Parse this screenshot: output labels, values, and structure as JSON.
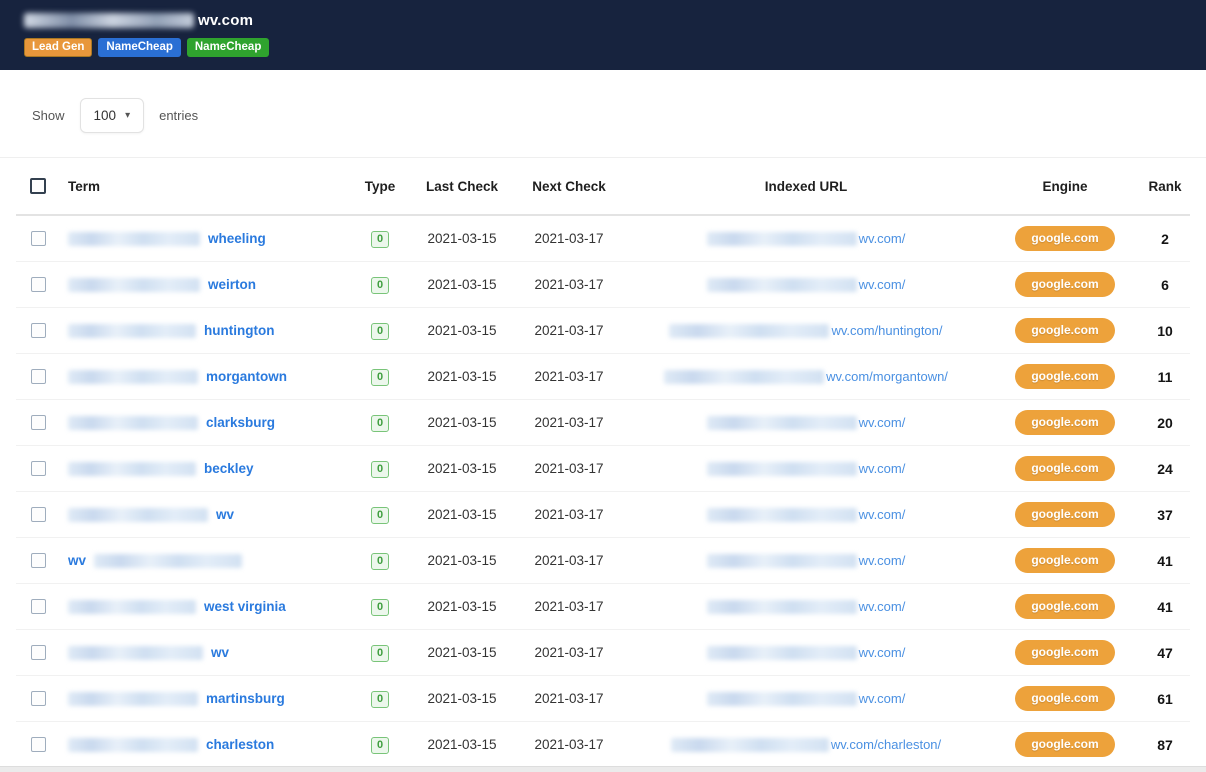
{
  "colors": {
    "header_bg": "#17233e",
    "engine_pill_orange": "#eda23b",
    "link_blue": "#2a7ade",
    "type_badge_green": "#3f9e3f",
    "badge_orange": "#e8973b",
    "badge_blue": "#2a6fd4",
    "badge_green": "#2fa32e"
  },
  "header": {
    "title_visible": "wv.com",
    "title_redacted": true,
    "badges": [
      {
        "label": "Lead Gen"
      },
      {
        "label": "NameCheap"
      },
      {
        "label": "NameCheap"
      }
    ]
  },
  "controls": {
    "show_label": "Show",
    "page_size": "100",
    "entries_label": "entries"
  },
  "table": {
    "headers": {
      "term": "Term",
      "type": "Type",
      "last_check": "Last Check",
      "next_check": "Next Check",
      "indexed_url": "Indexed URL",
      "engine": "Engine",
      "rank": "Rank"
    },
    "rows": [
      {
        "term": "wheeling",
        "term_blur_position": "before",
        "term_blur_width": 132,
        "type": "0",
        "last_check": "2021-03-15",
        "next_check": "2021-03-17",
        "url": "wv.com/",
        "url_blur_width": 150,
        "engine": "google.com",
        "rank": "2"
      },
      {
        "term": "weirton",
        "term_blur_position": "before",
        "term_blur_width": 132,
        "type": "0",
        "last_check": "2021-03-15",
        "next_check": "2021-03-17",
        "url": "wv.com/",
        "url_blur_width": 150,
        "engine": "google.com",
        "rank": "6"
      },
      {
        "term": "huntington",
        "term_blur_position": "before",
        "term_blur_width": 128,
        "type": "0",
        "last_check": "2021-03-15",
        "next_check": "2021-03-17",
        "url": "wv.com/huntington/",
        "url_blur_width": 160,
        "engine": "google.com",
        "rank": "10"
      },
      {
        "term": "morgantown",
        "term_blur_position": "before",
        "term_blur_width": 130,
        "type": "0",
        "last_check": "2021-03-15",
        "next_check": "2021-03-17",
        "url": "wv.com/morgantown/",
        "url_blur_width": 160,
        "engine": "google.com",
        "rank": "11"
      },
      {
        "term": "clarksburg",
        "term_blur_position": "before",
        "term_blur_width": 130,
        "type": "0",
        "last_check": "2021-03-15",
        "next_check": "2021-03-17",
        "url": "wv.com/",
        "url_blur_width": 150,
        "engine": "google.com",
        "rank": "20"
      },
      {
        "term": "beckley",
        "term_blur_position": "before",
        "term_blur_width": 128,
        "type": "0",
        "last_check": "2021-03-15",
        "next_check": "2021-03-17",
        "url": "wv.com/",
        "url_blur_width": 150,
        "engine": "google.com",
        "rank": "24"
      },
      {
        "term": "wv",
        "term_blur_position": "before",
        "term_blur_width": 140,
        "type": "0",
        "last_check": "2021-03-15",
        "next_check": "2021-03-17",
        "url": "wv.com/",
        "url_blur_width": 150,
        "engine": "google.com",
        "rank": "37"
      },
      {
        "term": "wv",
        "term_blur_position": "after",
        "term_blur_width": 148,
        "type": "0",
        "last_check": "2021-03-15",
        "next_check": "2021-03-17",
        "url": "wv.com/",
        "url_blur_width": 150,
        "engine": "google.com",
        "rank": "41"
      },
      {
        "term": "west virginia",
        "term_blur_position": "before",
        "term_blur_width": 128,
        "type": "0",
        "last_check": "2021-03-15",
        "next_check": "2021-03-17",
        "url": "wv.com/",
        "url_blur_width": 150,
        "engine": "google.com",
        "rank": "41"
      },
      {
        "term": "wv",
        "term_blur_position": "before",
        "term_blur_width": 135,
        "type": "0",
        "last_check": "2021-03-15",
        "next_check": "2021-03-17",
        "url": "wv.com/",
        "url_blur_width": 150,
        "engine": "google.com",
        "rank": "47"
      },
      {
        "term": "martinsburg",
        "term_blur_position": "before",
        "term_blur_width": 130,
        "type": "0",
        "last_check": "2021-03-15",
        "next_check": "2021-03-17",
        "url": "wv.com/",
        "url_blur_width": 150,
        "engine": "google.com",
        "rank": "61"
      },
      {
        "term": "charleston",
        "term_blur_position": "before",
        "term_blur_width": 130,
        "type": "0",
        "last_check": "2021-03-15",
        "next_check": "2021-03-17",
        "url": "wv.com/charleston/",
        "url_blur_width": 158,
        "engine": "google.com",
        "rank": "87"
      }
    ]
  }
}
